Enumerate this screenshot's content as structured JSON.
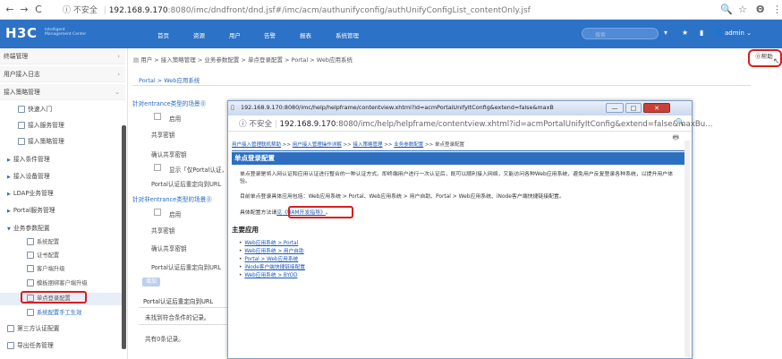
{
  "browser": {
    "back": "←",
    "forward": "→",
    "reload": "C",
    "info": "ⓘ",
    "insecure_label": "不安全",
    "url_host": "192.168.9.170",
    "url_rest": ":8080/imc/dndfront/dnd.jsf#/imc/acm/authunifyconfig/authUnifyConfigList_contentOnly.jsf",
    "zoom_icon": "🔍",
    "star_icon": "☆",
    "profile_icon": "Θ",
    "menu_icon": "⋮"
  },
  "app_header": {
    "logo": "H3C",
    "logo_sub1": "Intelligent",
    "logo_sub2": "Management Center",
    "nav": [
      "首页",
      "资源",
      "用户",
      "告警",
      "报表",
      "系统管理"
    ],
    "search_placeholder": "搜索",
    "admin": "admin ⌄"
  },
  "sidebar": {
    "terminal_mgmt": "终端管理",
    "user_access_log": "用户接入日志",
    "access_policy_mgmt": "接入策略管理",
    "quick_access": "快速入门",
    "access_service_mgmt": "接入服务管理",
    "access_policy_mgmt_sub": "接入策略管理",
    "access_condition_mgmt": "接入条件管理",
    "access_device_mgmt": "接入设备管理",
    "ldap_service_mgmt": "LDAP业务管理",
    "portal_service_mgmt": "Portal服务管理",
    "service_param_config": "业务参数配置",
    "system_config": "系统配置",
    "cert_config": "证书配置",
    "client_upgrade": "客户端升级",
    "binding_client_upgrade": "模板捆绑客户端升级",
    "sso_config": "单点登录配置",
    "manual_effect": "系统配置手工生效",
    "third_party_auth": "第三方认证配置",
    "export_task_mgmt": "导出任务管理"
  },
  "main": {
    "breadcrumb": "用户 > 接入策略管理 > 业务参数配置 > 单点登录配置 > Portal > Web应用系统",
    "subcrumb": "Portal > Web应用系统",
    "help": "帮助",
    "entrance_title": "针对entrance类型的场景",
    "enable": "启用",
    "shared_key": "共享密钥",
    "confirm_shared_key": "确认共享密钥",
    "show_portal": "显示「仅Portal认证，不...",
    "portal_redirect_url": "Portal认证后重定向到URL",
    "non_entrance_title": "针对非entrance类型的场景",
    "add_btn": "增加",
    "table_header": "Portal认证后重定向到URL",
    "no_records": "未找到符合条件的记录。",
    "total_records": "共有0条记录。"
  },
  "popup": {
    "title": "192.168.9.170:8080/imc/help/helpframe/contentview.xhtml?id=acmPortalUnifyItConfig&extend=false&maxButton=false&contentsFr...",
    "minimize": "—",
    "maximize": "□",
    "close": "✕",
    "insecure_label": "不安全",
    "url_host": "192.168.9.170",
    "url_rest": ":8080/imc/help/helpframe/contentview.xhtml?id=acmPortalUnifyItConfig&extend=false&maxBu...",
    "zoom_icon": "🔍",
    "print_icon": "🖶",
    "crumb": [
      "用户接入管理联机帮助",
      "用户接入管理操作详解",
      "接入策略管理",
      "业务参数配置",
      "单点登录配置"
    ],
    "header": "单点登录配置",
    "para1": "单点登录是将入网认证和应用认证进行整合的一种认证方式。即终端用户进行一次认证后，既可以顺利接入网络，又能访问各种Web应用系统，避免用户反复登录各种系统，以提升用户体验。",
    "para2": "目前单点登录具体应用包括：Web应用系统 > Portal、Web应用系统 > 用户自助、Portal > Web应用系统、iNode客户端快捷链接配置。",
    "para3_prefix": "具体配置方法请",
    "para3_link": "见《UAM开发指导》",
    "para3_suffix": "。",
    "main_apps": "主要应用",
    "apps": [
      "Web应用系统 > Portal",
      "Web应用系统 > 用户自助",
      "Portal > Web应用系统",
      "iNode客户端快捷链接配置",
      "Web应用系统 > BYOD"
    ]
  },
  "colors": {
    "brand_blue": "#2c72c7",
    "highlight_red": "#d81e1e",
    "link_blue": "#1a56b5"
  }
}
